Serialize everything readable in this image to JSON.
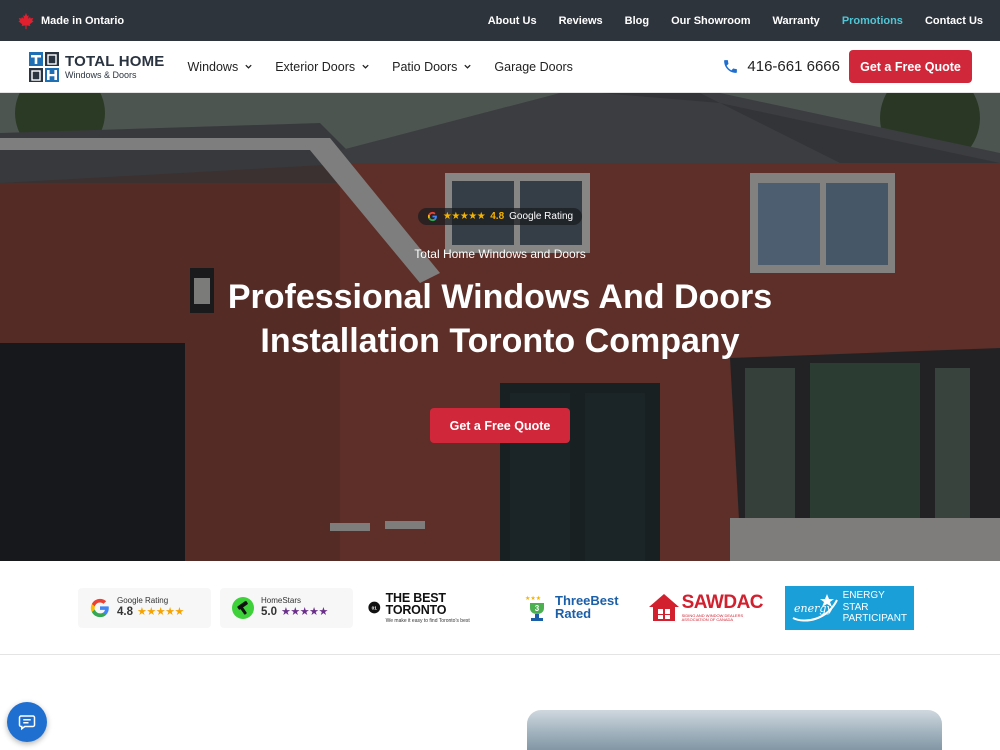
{
  "topbar": {
    "made_in": "Made in Ontario",
    "links": [
      "About Us",
      "Reviews",
      "Blog",
      "Our Showroom",
      "Warranty",
      "Promotions",
      "Contact Us"
    ]
  },
  "navbar": {
    "logo_title": "TOTAL HOME",
    "logo_sub": "Windows & Doors",
    "menu": [
      "Windows",
      "Exterior Doors",
      "Patio Doors",
      "Garage Doors"
    ],
    "phone": "416-661 6666",
    "quote_button": "Get a Free Quote"
  },
  "hero": {
    "rating_score": "4.8",
    "rating_label": "Google Rating",
    "rating_stars": "★★★★★",
    "subtitle": "Total Home Windows and Doors",
    "title": "Professional Windows And Doors Installation Toronto Company",
    "quote_button": "Get a Free Quote"
  },
  "badges": {
    "google": {
      "name": "Google Rating",
      "score": "4.8",
      "stars": "★★★★★"
    },
    "homestars": {
      "name": "HomeStars",
      "score": "5.0",
      "stars": "★★★★★"
    },
    "best_toronto": {
      "title": "THE BEST TORONTO",
      "sub": "We make it easy to find Toronto's best"
    },
    "three_best": {
      "line1": "ThreeBest",
      "line2": "Rated"
    },
    "sawdac": {
      "title": "SAWDAC",
      "sub": "SIDING AND WINDOW DEALERS ASSOCIATION OF CANADA"
    },
    "energy_star": {
      "line1": "ENERGY",
      "line2": "STAR",
      "line3": "PARTICIPANT"
    }
  },
  "colors": {
    "accent_red": "#d0283a",
    "topbar_bg": "#2e343c",
    "promo_teal": "#4fc6d6",
    "chat_blue": "#1f6fd1"
  }
}
